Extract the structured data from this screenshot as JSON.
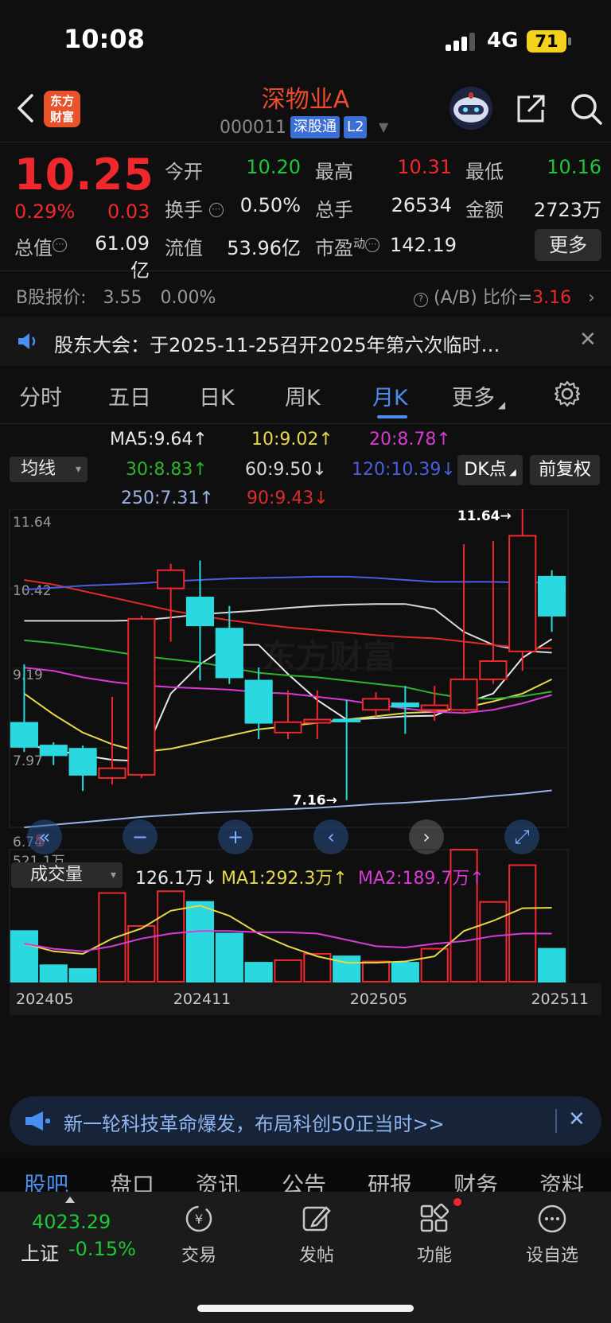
{
  "status_bar": {
    "time": "10:08",
    "network": "4G",
    "battery": "71"
  },
  "header": {
    "logo_line1": "东方",
    "logo_line2": "财富",
    "stock_name": "深物业A",
    "stock_code": "000011",
    "tag_connect": "深股通",
    "tag_level": "L2"
  },
  "quote": {
    "price": "10.25",
    "change_pct": "0.29%",
    "change_amt": "0.03",
    "open_label": "今开",
    "open": "10.20",
    "high_label": "最高",
    "high": "10.31",
    "low_label": "最低",
    "low": "10.16",
    "turnover_label": "换手",
    "turnover": "0.50%",
    "volume_label": "总手",
    "volume": "26534",
    "amount_label": "金额",
    "amount": "2723万",
    "mktcap_label": "总值",
    "mktcap": "61.09亿",
    "float_label": "流值",
    "float_cap": "53.96亿",
    "pe_label": "市盈",
    "pe_sup": "动",
    "pe": "142.19",
    "more_label": "更多"
  },
  "b_share": {
    "label": "B股报价:",
    "price": "3.55",
    "pct": "0.00%",
    "ratio_label": "(A/B) 比价=",
    "ratio": "3.16"
  },
  "notice": {
    "text": "股东大会：于2025-11-25召开2025年第六次临时…"
  },
  "k_tabs": [
    "分时",
    "五日",
    "日K",
    "周K",
    "月K",
    "更多"
  ],
  "ma": {
    "selector": "均线",
    "items": [
      {
        "text": "MA5:9.64↑",
        "color": "#e8e8e8"
      },
      {
        "text": "10:9.02↑",
        "color": "#e8d74a"
      },
      {
        "text": "20:8.78↑",
        "color": "#d93ad6"
      },
      {
        "text": "30:8.83↑",
        "color": "#2db52d"
      },
      {
        "text": "60:9.50↓",
        "color": "#d8d8d8"
      },
      {
        "text": "120:10.39↓",
        "color": "#4a5ee0"
      },
      {
        "text": "250:7.31↑",
        "color": "#9bb4e6"
      },
      {
        "text": "90:9.43↓",
        "color": "#e02a2a"
      }
    ],
    "dk_label": "DK点",
    "fq_label": "前复权"
  },
  "chart_data": {
    "type": "candlestick",
    "y_ticks": [
      "11.64",
      "10.42",
      "9.19",
      "7.97",
      "6.74"
    ],
    "ylim": [
      6.74,
      11.64
    ],
    "max_label": "11.64",
    "min_label": "7.16",
    "candles": [
      {
        "o": 8.35,
        "c": 7.98,
        "h": 9.25,
        "l": 7.9
      },
      {
        "o": 8.0,
        "c": 7.85,
        "h": 8.05,
        "l": 7.7
      },
      {
        "o": 7.95,
        "c": 7.55,
        "h": 8.0,
        "l": 7.3
      },
      {
        "o": 7.5,
        "c": 7.65,
        "h": 8.75,
        "l": 7.4
      },
      {
        "o": 7.55,
        "c": 9.95,
        "h": 10.0,
        "l": 7.5
      },
      {
        "o": 10.42,
        "c": 10.7,
        "h": 10.8,
        "l": 9.6
      },
      {
        "o": 10.28,
        "c": 9.85,
        "h": 10.85,
        "l": 9.0
      },
      {
        "o": 9.8,
        "c": 9.05,
        "h": 10.15,
        "l": 8.95
      },
      {
        "o": 9.0,
        "c": 8.35,
        "h": 9.2,
        "l": 8.1
      },
      {
        "o": 8.2,
        "c": 8.36,
        "h": 8.85,
        "l": 8.1
      },
      {
        "o": 8.35,
        "c": 8.4,
        "h": 8.85,
        "l": 8.1
      },
      {
        "o": 8.4,
        "c": 8.37,
        "h": 8.7,
        "l": 7.16
      },
      {
        "o": 8.55,
        "c": 8.72,
        "h": 8.82,
        "l": 8.45
      },
      {
        "o": 8.65,
        "c": 8.6,
        "h": 8.92,
        "l": 8.18
      },
      {
        "o": 8.55,
        "c": 8.62,
        "h": 8.92,
        "l": 8.38
      },
      {
        "o": 8.55,
        "c": 9.02,
        "h": 11.1,
        "l": 8.5
      },
      {
        "o": 9.02,
        "c": 9.3,
        "h": 11.15,
        "l": 8.95
      },
      {
        "o": 9.45,
        "c": 11.23,
        "h": 11.64,
        "l": 9.15
      },
      {
        "o": 10.6,
        "c": 10.0,
        "h": 10.7,
        "l": 9.75
      }
    ],
    "ma_lines": [
      {
        "name": "MA5",
        "color": "#e8e8e8",
        "values": [
          8.02,
          7.93,
          7.85,
          7.78,
          7.76,
          8.8,
          9.25,
          9.55,
          9.55,
          9.1,
          8.7,
          8.4,
          8.42,
          8.45,
          8.46,
          8.65,
          8.8,
          9.35,
          9.64
        ]
      },
      {
        "name": "MA10",
        "color": "#e8d74a",
        "values": [
          8.8,
          8.48,
          8.2,
          8.02,
          7.9,
          7.95,
          8.05,
          8.15,
          8.25,
          8.3,
          8.35,
          8.4,
          8.45,
          8.5,
          8.52,
          8.58,
          8.68,
          8.8,
          9.02
        ]
      },
      {
        "name": "MA20",
        "color": "#d93ad6",
        "values": [
          9.2,
          9.15,
          9.05,
          8.98,
          8.93,
          8.9,
          8.88,
          8.86,
          8.82,
          8.8,
          8.75,
          8.7,
          8.63,
          8.57,
          8.52,
          8.5,
          8.55,
          8.65,
          8.78
        ]
      },
      {
        "name": "MA30",
        "color": "#2db52d",
        "values": [
          9.62,
          9.58,
          9.52,
          9.45,
          9.38,
          9.33,
          9.28,
          9.2,
          9.12,
          9.08,
          9.05,
          9.0,
          8.95,
          8.9,
          8.8,
          8.73,
          8.72,
          8.76,
          8.83
        ]
      },
      {
        "name": "MA60",
        "color": "#d8d8d8",
        "values": [
          9.92,
          9.92,
          9.92,
          9.92,
          9.93,
          9.97,
          10.02,
          10.05,
          10.08,
          10.12,
          10.15,
          10.17,
          10.18,
          10.18,
          10.1,
          9.75,
          9.55,
          9.46,
          9.43
        ]
      },
      {
        "name": "MA90",
        "color": "#e02a2a",
        "values": [
          10.55,
          10.48,
          10.38,
          10.28,
          10.18,
          10.08,
          10.0,
          9.93,
          9.87,
          9.82,
          9.78,
          9.74,
          9.7,
          9.67,
          9.65,
          9.6,
          9.55,
          9.5,
          9.5
        ]
      },
      {
        "name": "MA120",
        "color": "#4a5ee0",
        "values": [
          10.4,
          10.43,
          10.46,
          10.48,
          10.5,
          10.53,
          10.55,
          10.57,
          10.58,
          10.59,
          10.6,
          10.6,
          10.58,
          10.55,
          10.52,
          10.52,
          10.52,
          10.51,
          10.51
        ]
      },
      {
        "name": "MA250",
        "color": "#9bb4e6",
        "values": [
          6.74,
          6.78,
          6.82,
          6.86,
          6.9,
          6.93,
          6.96,
          6.98,
          7.0,
          7.02,
          7.04,
          7.07,
          7.1,
          7.12,
          7.15,
          7.18,
          7.22,
          7.26,
          7.31
        ]
      }
    ],
    "volume": {
      "selector": "成交量",
      "current": "126.1万↓",
      "ma1": "MA1:292.3万↑",
      "ma2": "MA2:189.7万↑",
      "max_label": "521.1万",
      "ylim": [
        0,
        521.1
      ],
      "values": [
        200,
        65,
        50,
        350,
        220,
        357,
        315,
        190,
        75,
        85,
        110,
        100,
        80,
        75,
        130,
        521,
        315,
        460,
        130
      ],
      "ma1_values": [
        150,
        120,
        110,
        170,
        210,
        280,
        300,
        260,
        190,
        140,
        100,
        75,
        75,
        80,
        100,
        200,
        240,
        290,
        292
      ],
      "ma2_values": [
        150,
        130,
        120,
        140,
        170,
        190,
        200,
        200,
        195,
        195,
        190,
        165,
        140,
        135,
        150,
        160,
        180,
        190,
        190
      ],
      "x_labels": [
        "202405",
        "202411",
        "202505",
        "202511"
      ]
    }
  },
  "ad": {
    "text": "新一轮科技革命爆发，布局科创50正当时>>"
  },
  "bottom_tabs": [
    "股吧",
    "盘口",
    "资讯",
    "公告",
    "研报",
    "财务",
    "资料"
  ],
  "index": {
    "value": "4023.29",
    "name": "上证",
    "change": "-0.15%"
  },
  "nav": [
    "交易",
    "发帖",
    "功能",
    "设自选"
  ],
  "colors": {
    "up": "#f0282d",
    "down": "#1ec73a",
    "bear_candle": "#2ad9e0",
    "accent": "#4a8ff0"
  }
}
